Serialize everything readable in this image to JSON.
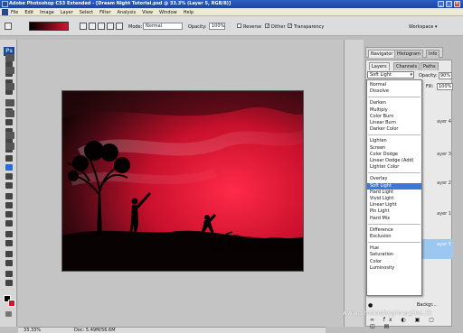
{
  "window": {
    "title": "Adobe Photoshop CS3 Extended - [Dream Night Tutorial.psd @ 33.3% (Layer 5, RGB/8)]"
  },
  "menu": [
    "File",
    "Edit",
    "Image",
    "Layer",
    "Select",
    "Filter",
    "Analysis",
    "View",
    "Window",
    "Help"
  ],
  "options": {
    "mode_label": "Mode:",
    "mode_value": "Normal",
    "opacity_label": "Opacity:",
    "opacity_value": "100%",
    "reverse_label": "Reverse",
    "dither_label": "Dither",
    "transparency_label": "Transparency",
    "workspace_label": "Workspace ▾"
  },
  "tools": {
    "ps_logo": "Ps"
  },
  "panels": {
    "tabs_top": [
      "Navigator",
      "Histogram",
      "Info"
    ],
    "tabs_layers": [
      "Layers",
      "Channels",
      "Paths"
    ],
    "blend_value": "Soft Light",
    "opacity_label": "Opacity:",
    "opacity_value": "90%",
    "fill_label": "Fill:",
    "fill_value": "100%",
    "layer_rows": [
      "ayer 4",
      "ayer 3",
      "ayer 2",
      "ayer 1",
      "ayer 5"
    ],
    "background_label": "Backgr..."
  },
  "blend_groups": [
    [
      "Normal",
      "Dissolve"
    ],
    [
      "Darken",
      "Multiply",
      "Color Burn",
      "Linear Burn",
      "Darker Color"
    ],
    [
      "Lighten",
      "Screen",
      "Color Dodge",
      "Linear Dodge (Add)",
      "Lighter Color"
    ],
    [
      "Overlay",
      "Soft Light",
      "Hard Light",
      "Vivid Light",
      "Linear Light",
      "Pin Light",
      "Hard Mix"
    ],
    [
      "Difference",
      "Exclusion"
    ],
    [
      "Hue",
      "Saturation",
      "Color",
      "Luminosity"
    ]
  ],
  "blend_selected": "Soft Light",
  "status": {
    "zoom": "33.33%",
    "doc": "Doc: 5.49M/56.6M"
  },
  "watermark": "www.photoshopimagine.tk",
  "colors": {
    "foreground": "#000000",
    "background": "#d5142e",
    "accent": "#3d78d8"
  }
}
